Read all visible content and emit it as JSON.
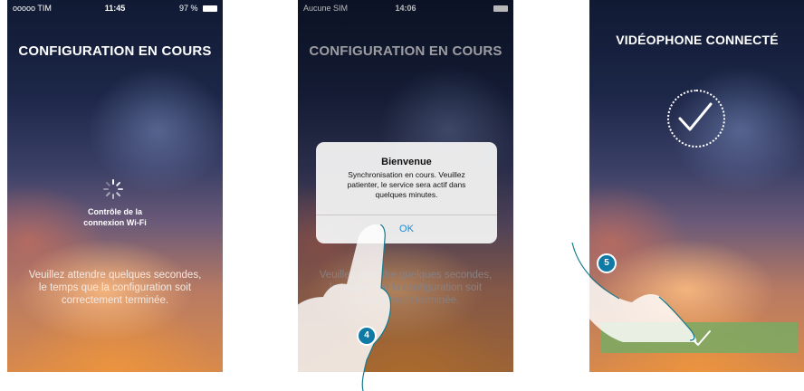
{
  "screen1": {
    "status": {
      "carrier": "ooooo TIM",
      "time": "11:45",
      "battery": "97 %"
    },
    "title": "CONFIGURATION EN COURS",
    "check_label_lines": [
      "Contrôle de la",
      "connexion Wi-Fi"
    ],
    "wait_lines": [
      "Veuillez attendre quelques secondes,",
      "le temps que la configuration soit",
      "correctement terminée."
    ]
  },
  "screen2": {
    "status": {
      "carrier": "Aucune SIM",
      "time": "14:06"
    },
    "title": "CONFIGURATION EN COURS",
    "background_lines": [
      "Veuillez attendre quelques secondes,",
      "le temps que la configuration soit",
      "correctement terminée."
    ],
    "alert": {
      "title": "Bienvenue",
      "message_lines": [
        "Synchronisation en cours. Veuillez",
        "patienter, le service sera actif dans",
        "quelques minutes."
      ],
      "ok_label": "OK"
    },
    "step_badge": "4"
  },
  "screen3": {
    "title": "VIDÉOPHONE CONNECTÉ",
    "step_badge": "5"
  },
  "colors": {
    "accent_blue": "#1e8ad6",
    "badge_teal": "#0f7aa6",
    "confirm_green": "#78aa64"
  }
}
